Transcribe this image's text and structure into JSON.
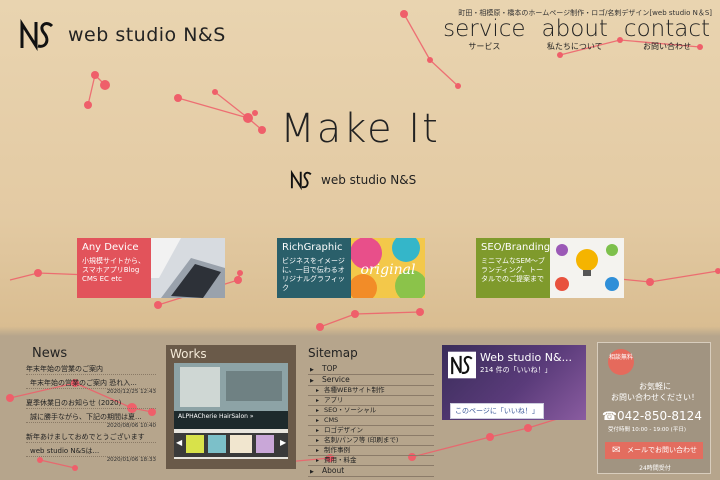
{
  "header": {
    "tagline": "町田・相模原・橋本のホームページ制作・ロゴ/名刺デザイン[web studio N＆S]",
    "logo_text": "web studio N&S"
  },
  "nav": [
    {
      "en": "service",
      "jp": "サービス"
    },
    {
      "en": "about",
      "jp": "私たちについて"
    },
    {
      "en": "contact",
      "jp": "お問い合わせ"
    }
  ],
  "hero": {
    "title": "Make It",
    "sub_logo_text": "web studio N&S"
  },
  "cards": [
    {
      "title": "Any Device",
      "desc": "小規模サイトから、スマホアプリBlog CMS EC etc",
      "color": "#e2535b"
    },
    {
      "title": "RichGraphic",
      "desc": "ビジネスをイメージに、一目で伝わるオリジナルグラフィック",
      "color": "#2a5f6a"
    },
    {
      "title": "SEO/Branding",
      "desc": "ミニマムなSEM～ブランディング、トータルでのご提案まで",
      "color": "#7f9a2c"
    }
  ],
  "news": {
    "title": "News",
    "items": [
      {
        "heading": "年末年始の営業のご案内",
        "text": "年末年始の営業のご案内 恐れ入...",
        "date": "2020/12/25 12:43"
      },
      {
        "heading": "夏季休業日のお知らせ (2020)",
        "text": "誠に勝手ながら、下記の期間は夏...",
        "date": "2020/08/06 10:40"
      },
      {
        "heading": "新年あけましておめでとうございます",
        "text": "web studio N&Sは...",
        "date": "2020/01/06 18:33"
      }
    ]
  },
  "works": {
    "title": "Works",
    "caption": "ALPHACherie HairSalon »"
  },
  "sitemap": {
    "title": "Sitemap",
    "items": [
      {
        "label": "TOP",
        "level": 1
      },
      {
        "label": "Service",
        "level": 1
      },
      {
        "label": "各種WEBサイト制作",
        "level": 2
      },
      {
        "label": "アプリ",
        "level": 2
      },
      {
        "label": "SEO・ソーシャル",
        "level": 2
      },
      {
        "label": "CMS",
        "level": 2
      },
      {
        "label": "ロゴデザイン",
        "level": 2
      },
      {
        "label": "名刺/パンフ等 (印刷まで)",
        "level": 2
      },
      {
        "label": "制作事例",
        "level": 2
      },
      {
        "label": "費用・料金",
        "level": 2
      },
      {
        "label": "About",
        "level": 1
      }
    ]
  },
  "facebook": {
    "title": "Web studio N&...",
    "likes": "214 件の「いいね！」",
    "button": "このページに「いいね！」"
  },
  "contact": {
    "badge": "相談無料",
    "message": "お気軽に\nお問い合わせください！",
    "tel": "☎042-850-8124",
    "hours": "受付時間 10:00 - 19:00 (平日)",
    "mail_button": "メールでお問い合わせ",
    "note": "24時間受付"
  },
  "colors": {
    "accent": "#e56a5c",
    "network_dot": "#f0606a"
  }
}
